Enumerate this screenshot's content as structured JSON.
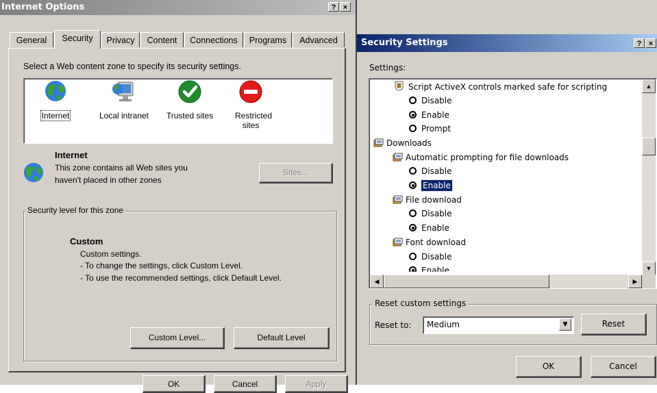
{
  "internet_options": {
    "title": "Internet Options",
    "help_button": "?",
    "close_button": "×",
    "tabs": [
      "General",
      "Security",
      "Privacy",
      "Content",
      "Connections",
      "Programs",
      "Advanced"
    ],
    "selected_tab": "Security",
    "zone_prompt": "Select a Web content zone to specify its security settings.",
    "zones": [
      {
        "label": "Internet",
        "icon": "globe-icon",
        "selected": true
      },
      {
        "label": "Local intranet",
        "icon": "local-intranet-icon"
      },
      {
        "label": "Trusted sites",
        "icon": "checkmark-icon"
      },
      {
        "label": "Restricted sites",
        "icon": "restricted-icon"
      }
    ],
    "zone_info": {
      "heading": "Internet",
      "description_line1": "This zone contains all Web sites you",
      "description_line2": "haven't placed in other zones"
    },
    "sites_button": "Sites...",
    "security_level": {
      "group_label": "Security level for this zone",
      "level_name": "Custom",
      "line1": "Custom settings.",
      "line2": "- To change the settings, click Custom Level.",
      "line3": "- To use the recommended settings, click Default Level."
    },
    "custom_level_button": "Custom Level...",
    "default_level_button": "Default Level",
    "ok_button": "OK",
    "cancel_button": "Cancel",
    "apply_button": "Apply"
  },
  "security_settings": {
    "title": "Security Settings",
    "help_button": "?",
    "close_button": "×",
    "settings_label": "Settings:",
    "list": {
      "script_activex": "Script ActiveX controls marked safe for scripting",
      "sa_disable": "Disable",
      "sa_enable": "Enable",
      "sa_prompt": "Prompt",
      "downloads": "Downloads",
      "auto_prompt": "Automatic prompting for file downloads",
      "ap_disable": "Disable",
      "ap_enable": "Enable",
      "file_download": "File download",
      "fd_disable": "Disable",
      "fd_enable": "Enable",
      "font_download": "Font download",
      "fo_disable": "Disable",
      "fo_enable": "Enable"
    },
    "reset_group_label": "Reset custom settings",
    "reset_to_label": "Reset to:",
    "reset_to_value": "Medium",
    "reset_button": "Reset",
    "ok_button": "OK",
    "cancel_button": "Cancel"
  },
  "colors": {
    "dialog_face": "#d4d0c8",
    "active_title": "#0a246a",
    "inactive_title": "#808080",
    "selection": "#0a246a"
  }
}
